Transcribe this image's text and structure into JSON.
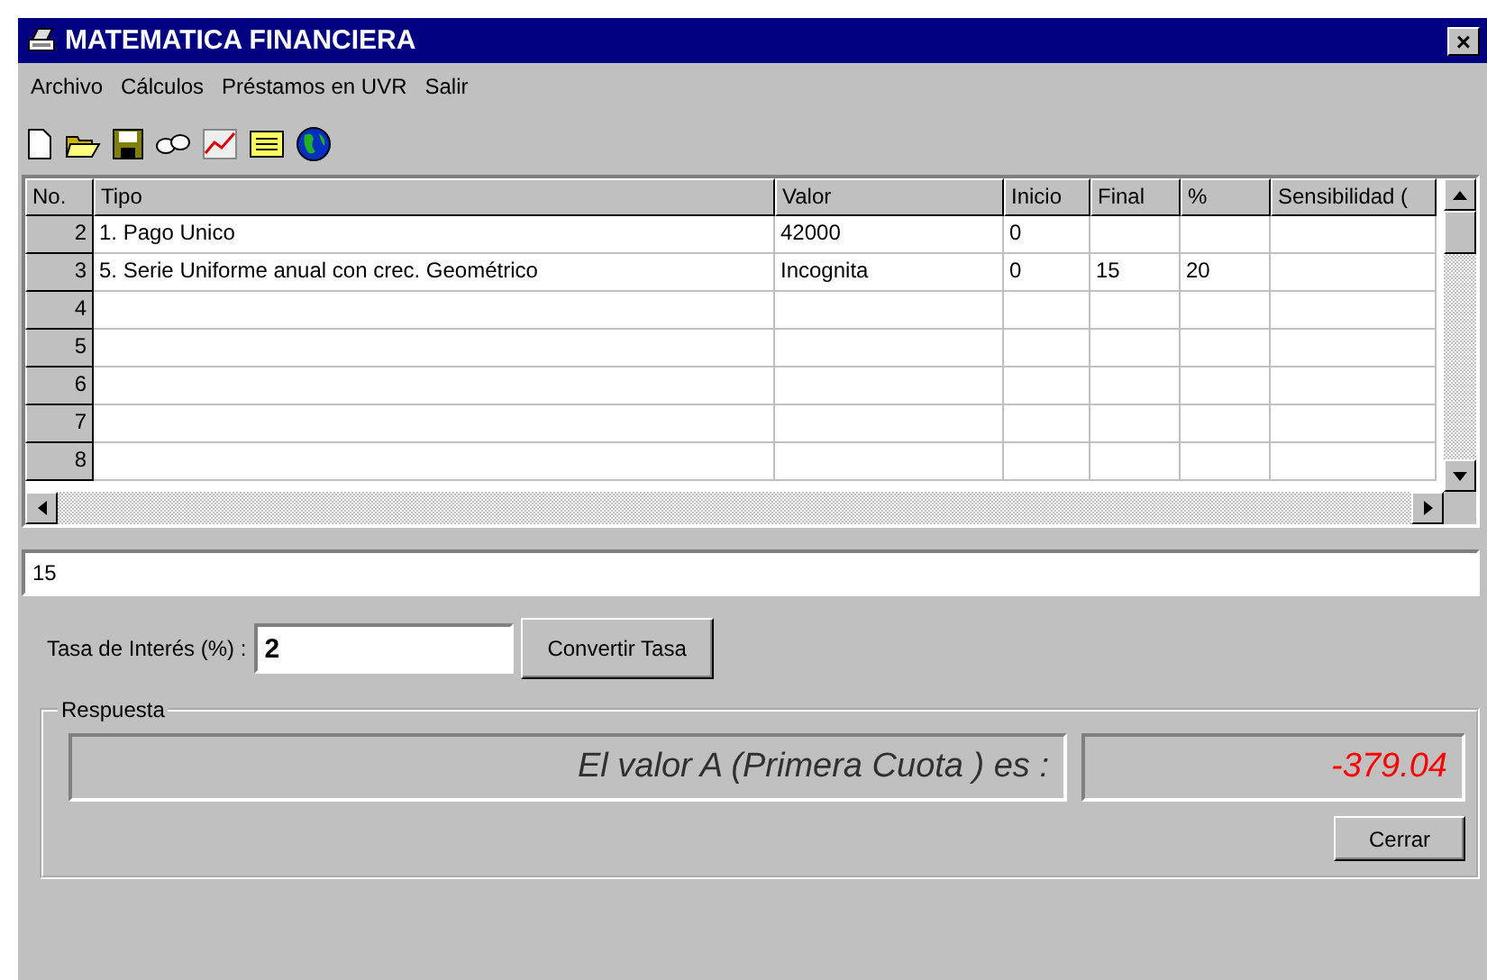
{
  "window": {
    "title": "MATEMATICA FINANCIERA",
    "close": "×"
  },
  "menu": [
    "Archivo",
    "Cálculos",
    "Préstamos en UVR",
    "Salir"
  ],
  "table": {
    "columns": [
      "No.",
      "Tipo",
      "Valor",
      "Inicio",
      "Final",
      "%",
      "Sensibilidad ("
    ],
    "rows": [
      {
        "cells": [
          "2",
          "1. Pago Unico",
          "42000",
          "0",
          "",
          "",
          ""
        ]
      },
      {
        "cells": [
          "3",
          "5. Serie Uniforme anual con crec. Geométrico",
          "Incognita",
          "0",
          "15",
          "20",
          ""
        ]
      },
      {
        "cells": [
          "4",
          "",
          "",
          "",
          "",
          "",
          ""
        ]
      },
      {
        "cells": [
          "5",
          "",
          "",
          "",
          "",
          "",
          ""
        ]
      },
      {
        "cells": [
          "6",
          "",
          "",
          "",
          "",
          "",
          ""
        ]
      },
      {
        "cells": [
          "7",
          "",
          "",
          "",
          "",
          "",
          ""
        ]
      },
      {
        "cells": [
          "8",
          "",
          "",
          "",
          "",
          "",
          ""
        ]
      }
    ]
  },
  "edit_field": {
    "value": "15"
  },
  "rate": {
    "label": "Tasa de Interés (%) :",
    "value": "2",
    "button": "Convertir Tasa"
  },
  "answer": {
    "group": "Respuesta",
    "label": "El valor A (Primera Cuota ) es :",
    "result": "-379.04",
    "close_button": "Cerrar"
  }
}
